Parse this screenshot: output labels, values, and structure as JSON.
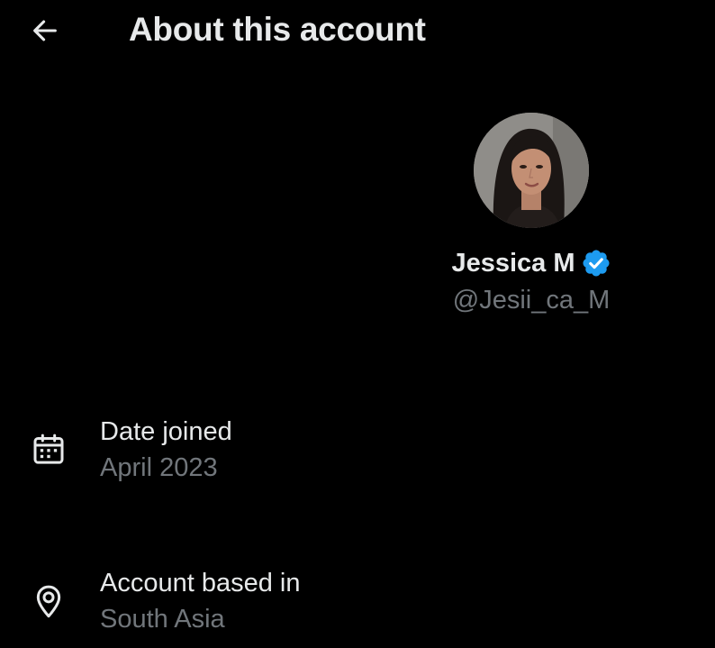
{
  "header": {
    "back_icon": "arrow-left-icon",
    "title": "About this account"
  },
  "profile": {
    "avatar_icon": "profile-photo",
    "display_name": "Jessica M",
    "verified_icon": "verified-badge-icon",
    "verified_color": "#1d9bf0",
    "handle": "@Jesii_ca_M"
  },
  "details": {
    "date_joined": {
      "icon": "calendar-icon",
      "label": "Date joined",
      "value": "April 2023"
    },
    "account_based_in": {
      "icon": "location-pin-icon",
      "label": "Account based in",
      "value": "South Asia"
    }
  },
  "colors": {
    "background": "#000000",
    "primary_text": "#e7e9ea",
    "secondary_text": "#71767b",
    "accent": "#1d9bf0"
  }
}
